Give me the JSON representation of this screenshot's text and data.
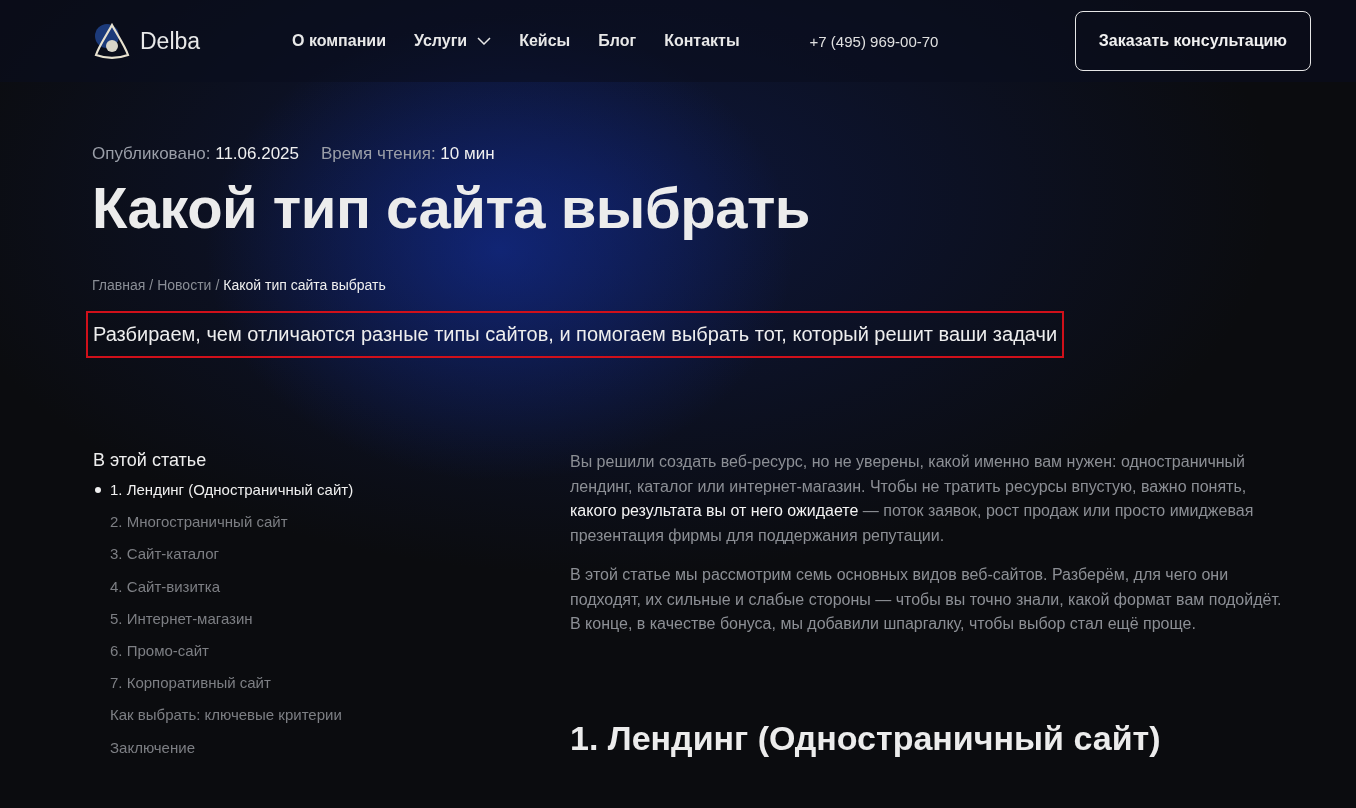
{
  "header": {
    "logo_text": "Delba",
    "nav": [
      {
        "label": "О компании",
        "has_dropdown": false
      },
      {
        "label": "Услуги",
        "has_dropdown": true
      },
      {
        "label": "Кейсы",
        "has_dropdown": false
      },
      {
        "label": "Блог",
        "has_dropdown": false
      },
      {
        "label": "Контакты",
        "has_dropdown": false
      }
    ],
    "phone": "+7 (495) 969-00-70",
    "cta_button": "Заказать консультацию"
  },
  "meta": [
    {
      "label": "Опубликовано:",
      "value": "11.06.2025"
    },
    {
      "label": "Время чтения:",
      "value": "10 мин"
    }
  ],
  "title": "Какой тип сайта выбрать",
  "breadcrumbs": [
    {
      "label": "Главная",
      "current": false
    },
    {
      "label": "Новости",
      "current": false
    },
    {
      "label": "Какой тип сайта выбрать",
      "current": true
    }
  ],
  "breadcrumb_separator": "/",
  "lead": {
    "text": "Разбираем, чем отличаются разные типы сайтов, и помогаем выбрать тот, который решит ваши задачи",
    "highlighted": true
  },
  "toc": {
    "title": "В этой статье",
    "items": [
      {
        "label": "1. Лендинг (Одностраничный сайт)",
        "selected": true
      },
      {
        "label": "2. Многостраничный сайт",
        "selected": false
      },
      {
        "label": "3. Сайт-каталог",
        "selected": false
      },
      {
        "label": "4. Сайт-визитка",
        "selected": false
      },
      {
        "label": "5. Интернет-магазин",
        "selected": false
      },
      {
        "label": "6. Промо-сайт",
        "selected": false
      },
      {
        "label": "7. Корпоративный сайт",
        "selected": false
      },
      {
        "label": "Как выбрать: ключевые критерии",
        "selected": false
      },
      {
        "label": "Заключение",
        "selected": false
      }
    ]
  },
  "article": {
    "paragraphs": [
      "Вы решили создать веб-ресурс, но не уверены, какой именно вам нужен: одностраничный лендинг, каталог или интернет-магазин. Чтобы не тратить ресурсы впустую, важно понять, **какого результата вы от него ожидаете** — поток заявок, рост продаж или просто имиджевая презентация фирмы для поддержания репутации.",
      "В этой статье мы рассмотрим семь основных видов веб-сайтов. Разберём, для чего они подходят, их сильные и слабые стороны — чтобы вы точно знали, какой формат вам подойдёт. В конце, в качестве бонуса, мы добавили шпаргалку, чтобы выбор стал ещё проще."
    ],
    "section_heading": "1. Лендинг (Одностраничный сайт)"
  }
}
